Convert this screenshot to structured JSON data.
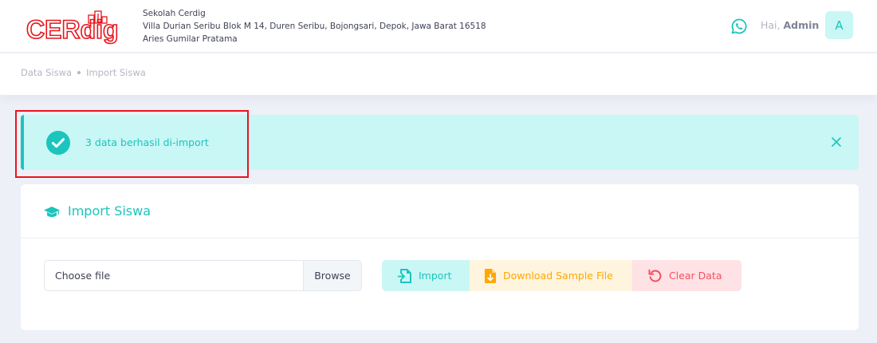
{
  "brand": {
    "logo_text": "CERdig"
  },
  "school": {
    "name": "Sekolah Cerdig",
    "address": "Villa Durian Seribu Blok M 14, Duren Seribu, Bojongsari, Depok, Jawa Barat 16518",
    "principal": "Aries Gumilar Pratama"
  },
  "user": {
    "greeting": "Hai,",
    "name": "Admin",
    "avatar_initial": "A"
  },
  "breadcrumb": [
    "Data Siswa",
    "Import Siswa"
  ],
  "alert": {
    "message": "3 data berhasil di-import"
  },
  "card": {
    "title": "Import Siswa",
    "file_input": {
      "placeholder": "Choose file",
      "browse_label": "Browse"
    },
    "buttons": {
      "import": "Import",
      "download": "Download Sample File",
      "clear": "Clear Data"
    }
  },
  "colors": {
    "accent": "#1bc5bd",
    "accent_light": "#c9f7f5",
    "warning": "#ffa800",
    "warning_light": "#fff4de",
    "danger": "#f64e60",
    "danger_light": "#ffe2e5",
    "logo_red": "#e8141c"
  },
  "icons": {
    "whatsapp": "whatsapp-icon",
    "alert": "check-circle-icon",
    "close": "close-icon",
    "card": "graduation-cap-icon",
    "import": "file-import-icon",
    "download": "file-download-icon",
    "clear": "undo-icon"
  }
}
